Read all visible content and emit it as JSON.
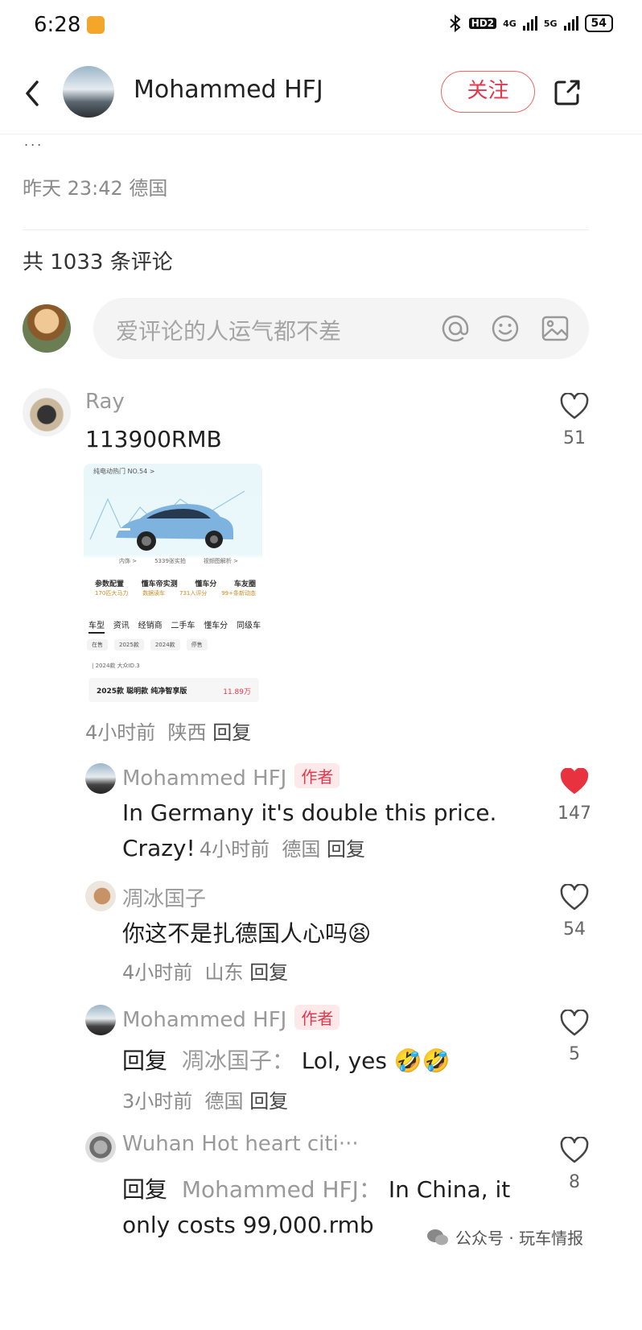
{
  "status_bar": {
    "time": "6:28",
    "network_1": "HD2",
    "net_4g": "4G",
    "net_5g": "5G",
    "battery": "54"
  },
  "header": {
    "username": "Mohammed HFJ",
    "follow_label": "关注"
  },
  "post": {
    "partial_text": "...",
    "meta": "昨天 23:42 德国",
    "comment_count_label": "共 1033 条评论"
  },
  "input": {
    "placeholder": "爱评论的人运气都不差"
  },
  "comments": [
    {
      "name": "Ray",
      "text": "113900RMB",
      "meta_time": "4小时前",
      "meta_loc": "陕西",
      "reply_label": "回复",
      "likes": "51",
      "liked": false,
      "screenshot": {
        "header": "纯电动热门 NO.54 >",
        "stats_labels": [
          "参数配置",
          "懂车帝实测",
          "懂车分",
          "车友圈"
        ],
        "stats_values": [
          "170匹大马力",
          "数据读车",
          "731人评分",
          "99+条新动态"
        ],
        "submenu": [
          "内饰 >",
          "5339张实拍",
          "视频图解析 >"
        ],
        "tabs": [
          "车型",
          "资讯",
          "经销商",
          "二手车",
          "懂车分",
          "同级车"
        ],
        "chips": [
          "在售",
          "2025款",
          "2024款",
          "停售"
        ],
        "model_line": "| 2024款 大众ID.3",
        "trim": "2025款 聪明款 纯净智享版",
        "price": "11.89万"
      }
    },
    {
      "name": "Mohammed HFJ",
      "tag": "作者",
      "text_line1": "In Germany it's double this price.",
      "text_line2": "Crazy!",
      "meta_time": "4小时前",
      "meta_loc": "德国",
      "reply_label": "回复",
      "likes": "147",
      "liked": true
    },
    {
      "name": "凋冰国子",
      "text": "你这不是扎德国人心吗",
      "emoji": "😫",
      "meta_time": "4小时前",
      "meta_loc": "山东",
      "reply_label": "回复",
      "likes": "54",
      "liked": false
    },
    {
      "name": "Mohammed HFJ",
      "tag": "作者",
      "reply_prefix": "回复",
      "reply_to": "凋冰国子：",
      "text": "Lol, yes",
      "emoji": "🤣🤣",
      "meta_time": "3小时前",
      "meta_loc": "德国",
      "reply_label": "回复",
      "likes": "5",
      "liked": false
    },
    {
      "name": "Wuhan Hot heart citi···",
      "reply_prefix": "回复",
      "reply_to": "Mohammed HFJ：",
      "text_line1": "In China, it",
      "text_line2": "only costs 99,000.rmb",
      "likes": "8",
      "liked": false
    }
  ],
  "watermark": "公众号 · 玩车情报",
  "colors": {
    "accent": "#e2384d",
    "text_muted": "#8a8a8a",
    "input_bg": "#f4f4f5"
  }
}
